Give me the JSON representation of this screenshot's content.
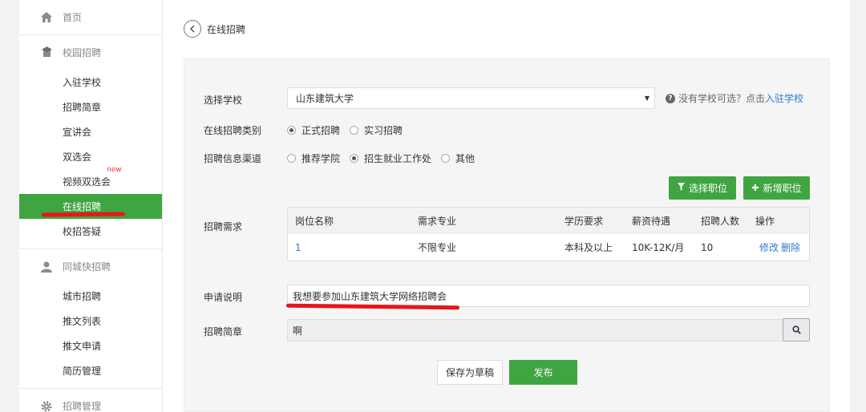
{
  "sidebar": {
    "home": {
      "label": "首页"
    },
    "campus": {
      "label": "校园招聘",
      "items": [
        {
          "label": "入驻学校"
        },
        {
          "label": "招聘简章"
        },
        {
          "label": "宣讲会"
        },
        {
          "label": "双选会"
        },
        {
          "label": "视频双选会",
          "badge": "new"
        },
        {
          "label": "在线招聘",
          "active": true
        },
        {
          "label": "校招答疑"
        }
      ]
    },
    "city": {
      "label": "同城快招聘",
      "items": [
        {
          "label": "城市招聘"
        },
        {
          "label": "推文列表"
        },
        {
          "label": "推文申请"
        },
        {
          "label": "简历管理"
        }
      ]
    },
    "manage": {
      "label": "招聘管理"
    }
  },
  "header": {
    "title": "在线招聘"
  },
  "form": {
    "school": {
      "label": "选择学校",
      "value": "山东建筑大学",
      "help_text": "没有学校可选？点击",
      "help_link": "入驻学校"
    },
    "category": {
      "label": "在线招聘类别",
      "options": [
        {
          "label": "正式招聘",
          "selected": true
        },
        {
          "label": "实习招聘",
          "selected": false
        }
      ]
    },
    "channel": {
      "label": "招聘信息渠道",
      "options": [
        {
          "label": "推荐学院",
          "selected": false
        },
        {
          "label": "招生就业工作处",
          "selected": true
        },
        {
          "label": "其他",
          "selected": false
        }
      ]
    },
    "select_position_button": "选择职位",
    "add_position_button": "新增职位",
    "requirements": {
      "label": "招聘需求",
      "columns": [
        "岗位名称",
        "需求专业",
        "学历要求",
        "薪资待遇",
        "招聘人数",
        "操作"
      ],
      "rows": [
        {
          "name": "1",
          "major": "不限专业",
          "education": "本科及以上",
          "salary": "10K-12K/月",
          "count": "10",
          "edit": "修改",
          "delete": "删除"
        }
      ]
    },
    "description": {
      "label": "申请说明",
      "value": "我想要参加山东建筑大学网络招聘会"
    },
    "brochure": {
      "label": "招聘简章",
      "value": "啊"
    },
    "save_draft_button": "保存为草稿",
    "publish_button": "发布"
  },
  "colors": {
    "accent": "#3fa540",
    "link": "#2f7bd1",
    "annotation": "#e8151b"
  }
}
